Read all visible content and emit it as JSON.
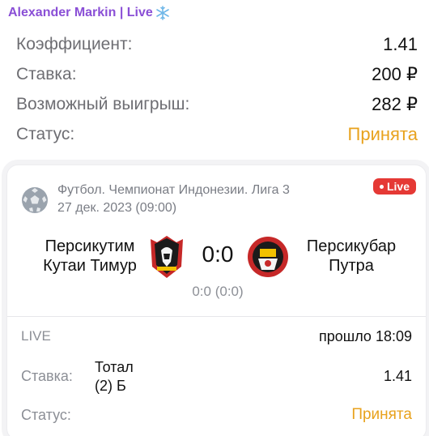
{
  "header": {
    "sender": "Alexander Markin | Live",
    "sender_emoji_icon": "snowflake-icon",
    "accent_color": "#8a4fd6"
  },
  "summary": {
    "rows": [
      {
        "label": "Коэффициент:",
        "value": "1.41"
      },
      {
        "label": "Ставка:",
        "value": "200 ₽"
      },
      {
        "label": "Возможный выигрыш:",
        "value": "282 ₽"
      },
      {
        "label": "Статус:",
        "value": "Принята"
      }
    ],
    "status_color": "#e8a21d"
  },
  "card": {
    "sport_icon": "soccer-ball-icon",
    "league": "Футбол. Чемпионат Индонезии. Лига 3",
    "datetime": "27 дек. 2023 (09:00)",
    "live_badge": "Live",
    "live_badge_color": "#e53935",
    "team1": {
      "line1": "Персикутим",
      "line2": "Кутаи Тимур",
      "logo": "team1-crest-icon"
    },
    "team2": {
      "line1": "Персикубар",
      "line2": "Путра",
      "logo": "team2-crest-icon"
    },
    "score": "0:0",
    "sub_score": "0:0 (0:0)",
    "live_label": "LIVE",
    "elapsed": "прошло 18:09",
    "bet_label": "Ставка:",
    "bet_market_line1": "Тотал",
    "bet_market_line2": "(2) Б",
    "bet_coef": "1.41",
    "status_label": "Статус:",
    "status_value": "Принята"
  }
}
